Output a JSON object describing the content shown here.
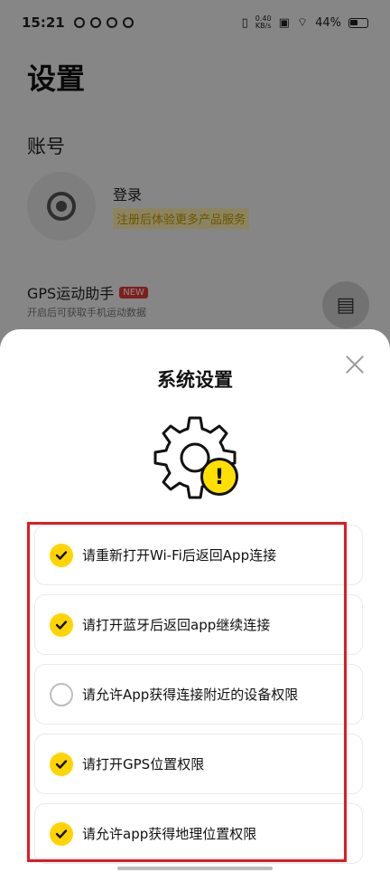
{
  "statusbar": {
    "time": "15:21",
    "net_speed_value": "0.40",
    "net_speed_unit": "KB/s",
    "battery": "44%"
  },
  "background_page": {
    "title": "设置",
    "account_section": "账号",
    "login_label": "登录",
    "register_tip": "注册后体验更多产品服务",
    "gps_title": "GPS运动助手",
    "gps_badge": "NEW",
    "gps_subtitle": "开启后可获取手机运动数据"
  },
  "dialog": {
    "title": "系统设置",
    "warning_mark": "!",
    "items": [
      {
        "label": "请重新打开Wi-Fi后返回App连接",
        "checked": true
      },
      {
        "label": "请打开蓝牙后返回app继续连接",
        "checked": true
      },
      {
        "label": "请允许App获得连接附近的设备权限",
        "checked": false
      },
      {
        "label": "请打开GPS位置权限",
        "checked": true
      },
      {
        "label": "请允许app获得地理位置权限",
        "checked": true
      }
    ]
  },
  "colors": {
    "accent": "#ffd400",
    "highlight_border": "#e11b22",
    "register_tip": "#c79a00"
  },
  "icons": {
    "close": "close-icon",
    "gear": "gear-icon",
    "warning": "warning-icon",
    "book": "book-icon",
    "check": "check-icon"
  }
}
